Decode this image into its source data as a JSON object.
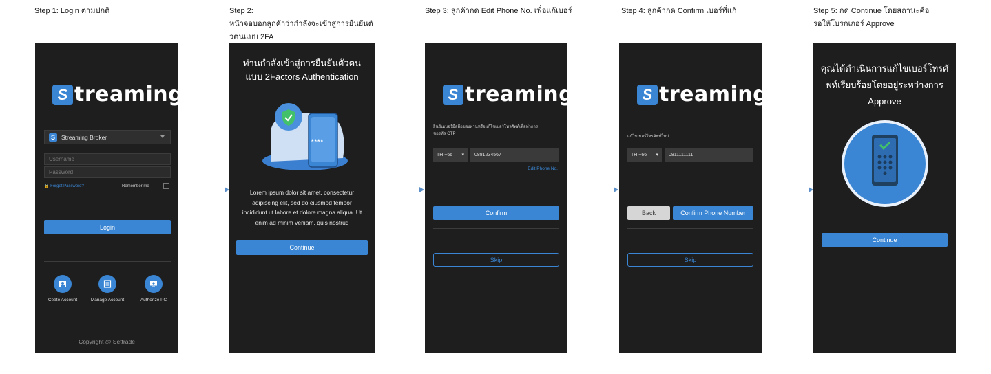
{
  "steps": [
    {
      "caption_line1": "Step 1: Login ตามปกติ",
      "caption_line2": "",
      "caption_line3": ""
    },
    {
      "caption_line1": "Step 2:",
      "caption_line2": "หน้าจอบอกลูกค้าว่ากำลังจะเข้าสู่การยืนยันตั",
      "caption_line3": "วตนแบบ 2FA"
    },
    {
      "caption_line1": "Step 3:  ลูกค้ากด Edit Phone No. เพื่อแก้เบอร์",
      "caption_line2": "",
      "caption_line3": ""
    },
    {
      "caption_line1": "Step 4:  ลูกค้ากด Confirm เบอร์ที่แก้",
      "caption_line2": "",
      "caption_line3": ""
    },
    {
      "caption_line1": "Step 5:  กด Continue โดยสถานะคือ",
      "caption_line2": "รอให้โบรกเกอร์ Approve",
      "caption_line3": ""
    }
  ],
  "brand": {
    "logo_letter": "S",
    "logo_text": "treaming",
    "accent": "#3a86d4"
  },
  "screen1": {
    "broker": "Streaming Broker",
    "username_placeholder": "Username",
    "password_placeholder": "Password",
    "forgot": "Forget Password?",
    "remember": "Remember me",
    "login": "Login",
    "create": "Ceate Account",
    "manage": "Manage Account",
    "authorize": "Authorize PC",
    "copyright": "Copyright @ Settrade"
  },
  "screen2": {
    "title_line1": "ท่านกำลังเข้าสู่การยืนยันตัวตน",
    "title_line2": "แบบ 2Factors Authentication",
    "pin_mask": "****",
    "body_line1": "Lorem ipsum dolor sit amet, consectetur",
    "body_line2": "adipiscing elit, sed do eiusmod tempor",
    "body_line3": "incididunt ut labore et dolore magna aliqua. Ut",
    "body_line4": "enim ad minim veniam, quis nostrud",
    "continue": "Continue"
  },
  "screen3": {
    "desc_line1": "ยืนยันเบอร์มือถือของท่านหรือแก้ไขเบอร์โทรศัพท์เพื่อทำการ",
    "desc_line2": "ขอรหัส OTP",
    "country_code": "TH +66",
    "phone": "0881234567",
    "edit_link": "Edit Phone No.",
    "confirm": "Confirm",
    "skip": "Skip"
  },
  "screen4": {
    "desc": "แก้ไขเบอร์โทรศัพท์ใหม่",
    "country_code": "TH +66",
    "phone": "0811111111",
    "back": "Back",
    "confirm": "Confirm Phone Number",
    "skip": "Skip"
  },
  "screen5": {
    "title_line1": "คุณได้ดำเนินการแก้ไขเบอร์โทรศั",
    "title_line2": "พท์เรียบร้อยโดยอยู่ระหว่างการ",
    "title_line3": "Approve",
    "continue": "Continue"
  }
}
